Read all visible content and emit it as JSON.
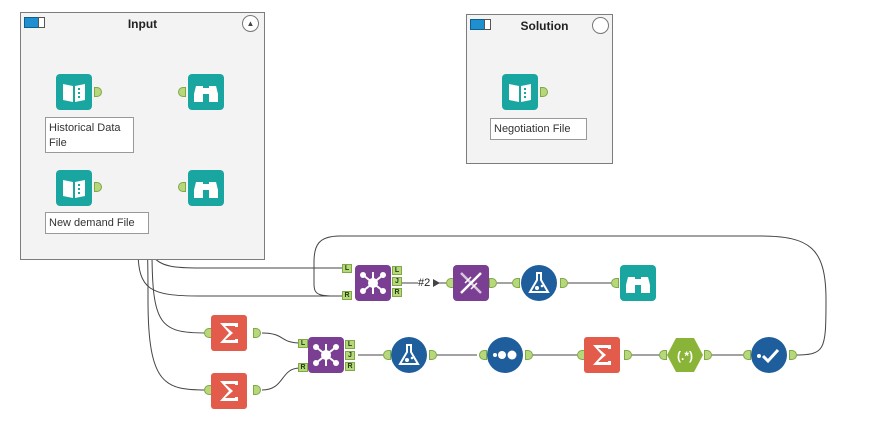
{
  "containers": {
    "input": {
      "title": "Input"
    },
    "solution": {
      "title": "Solution"
    }
  },
  "annotations": {
    "historical": "Historical Data File",
    "new_demand": "New demand File",
    "negotiation": "Negotiation File"
  },
  "join_anchor_labels": {
    "left": "L",
    "join": "J",
    "right": "R"
  },
  "connection_badge": "#2",
  "colors": {
    "input_tool": "#1aa6a0",
    "browse_tool": "#1aa6a0",
    "join_tool": "#7a3f92",
    "summarize_tool": "#e25b4b",
    "formula_tool": "#1f5e9c",
    "regex_tool": "#8ab437",
    "anchor": "#b6d77a"
  },
  "icons": [
    "book-input-icon",
    "binoculars-icon",
    "join-icon",
    "sigma-icon",
    "flask-icon",
    "dna-icon",
    "dots-icon",
    "regex-icon",
    "check-icon"
  ]
}
